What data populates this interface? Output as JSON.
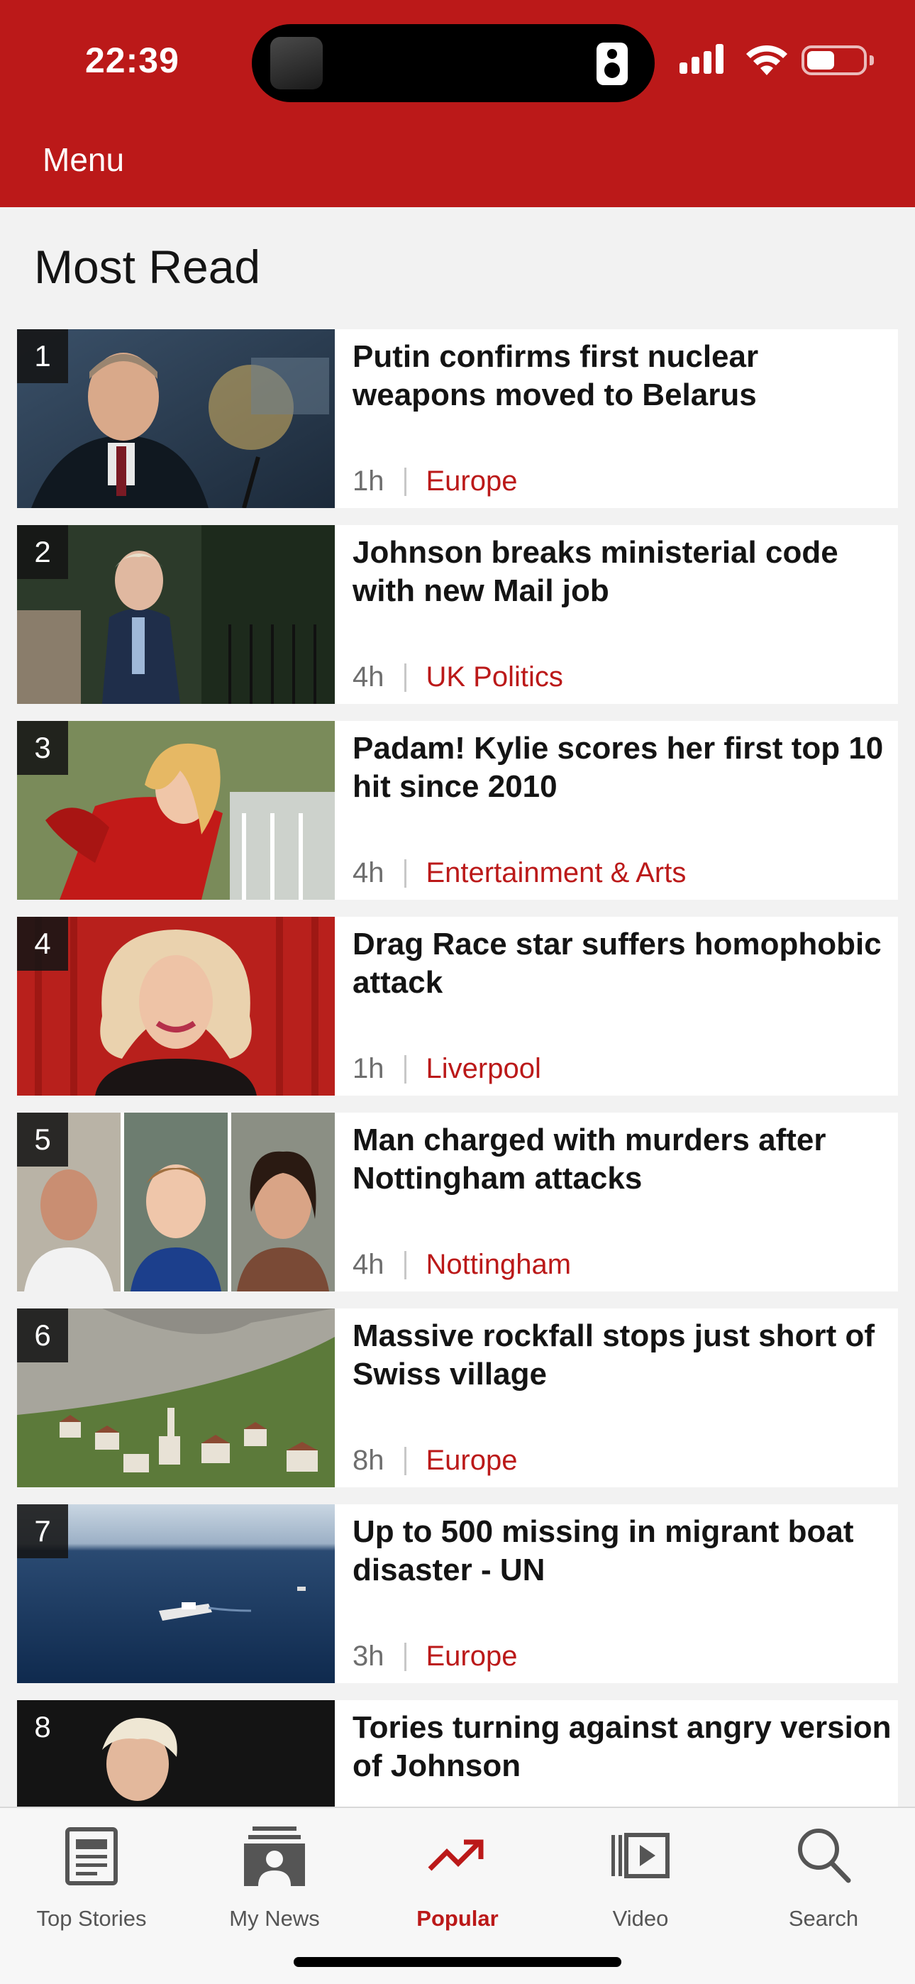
{
  "status_bar": {
    "time": "22:39"
  },
  "header": {
    "menu_label": "Menu"
  },
  "section_title": "Most Read",
  "stories": [
    {
      "rank": "1",
      "headline": "Putin confirms first nuclear weapons moved to Belarus",
      "time": "1h",
      "tag": "Europe"
    },
    {
      "rank": "2",
      "headline": "Johnson breaks ministerial code with new Mail job",
      "time": "4h",
      "tag": "UK Politics"
    },
    {
      "rank": "3",
      "headline": "Padam! Kylie scores her first top 10 hit since 2010",
      "time": "4h",
      "tag": "Entertainment & Arts"
    },
    {
      "rank": "4",
      "headline": "Drag Race star suffers homophobic attack",
      "time": "1h",
      "tag": "Liverpool"
    },
    {
      "rank": "5",
      "headline": "Man charged with murders after Nottingham attacks",
      "time": "4h",
      "tag": "Nottingham"
    },
    {
      "rank": "6",
      "headline": "Massive rockfall stops just short of Swiss village",
      "time": "8h",
      "tag": "Europe"
    },
    {
      "rank": "7",
      "headline": "Up to 500 missing in migrant boat disaster - UN",
      "time": "3h",
      "tag": "Europe"
    },
    {
      "rank": "8",
      "headline": "Tories turning against angry version of Johnson",
      "time": "",
      "tag": ""
    }
  ],
  "tabs": [
    {
      "label": "Top Stories",
      "icon": "top-stories-icon"
    },
    {
      "label": "My News",
      "icon": "my-news-icon"
    },
    {
      "label": "Popular",
      "icon": "popular-icon"
    },
    {
      "label": "Video",
      "icon": "video-icon"
    },
    {
      "label": "Search",
      "icon": "search-icon"
    }
  ],
  "colors": {
    "brand": "#bb1919",
    "background": "#f2f2f2",
    "active_tab": "#bb1919"
  }
}
